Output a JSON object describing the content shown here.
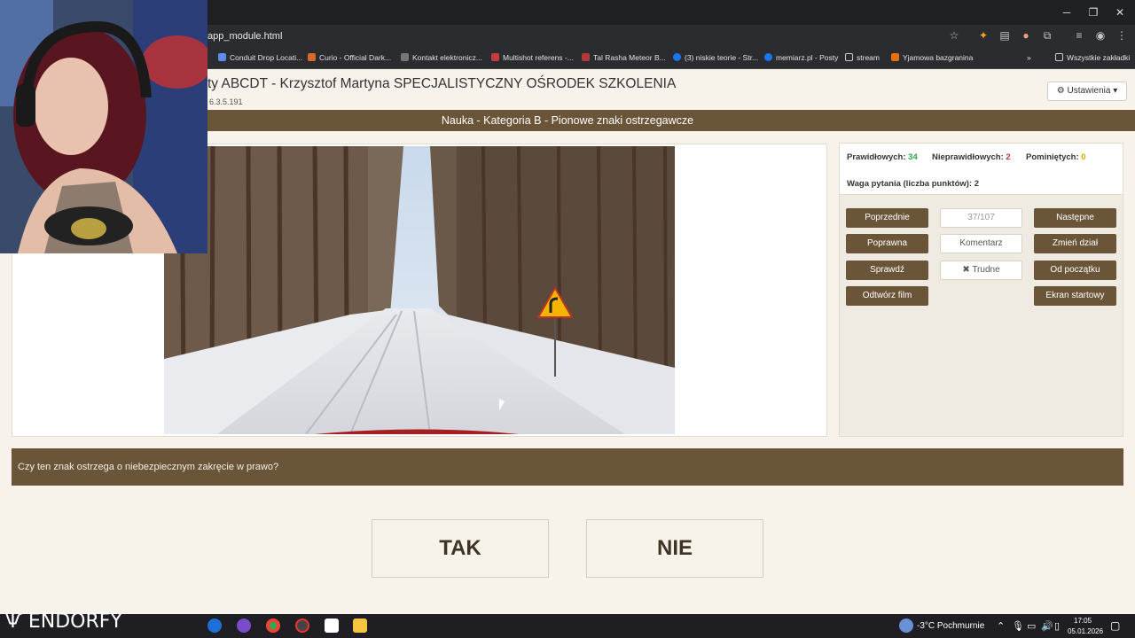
{
  "browser": {
    "url": "app_module.html",
    "bookmarks": [
      {
        "label": "Conduit Drop Locati...",
        "color": "#5a8dee"
      },
      {
        "label": "Curio - Official Dark...",
        "color": "#d86a2a"
      },
      {
        "label": "Kontakt elektronicz...",
        "color": "#777"
      },
      {
        "label": "Multishot referens -...",
        "color": "#c43c3c"
      },
      {
        "label": "Tal Rasha Meteor B...",
        "color": "#b03a3a"
      },
      {
        "label": "(3) niskie teorie - Str...",
        "color": "#1877f2"
      },
      {
        "label": "memiarz.pl - Posty",
        "color": "#1877f2"
      },
      {
        "label": "stream",
        "color": "#888"
      },
      {
        "label": "Yjamowa bazgranina",
        "color": "#e8710a"
      }
    ],
    "all_bookmarks": "Wszystkie zakładki"
  },
  "header": {
    "title": "ty ABCDT - Krzysztof Martyna SPECJALISTYCZNY OŚRODEK SZKOLENIA",
    "version": "6.3.5.191",
    "settings": "Ustawienia"
  },
  "category": "Nauka - Kategoria B - Pionowe znaki ostrzegawcze",
  "stats": {
    "correct_label": "Prawidłowych:",
    "correct_value": "34",
    "correct_color": "#2aa84a",
    "wrong_label": "Nieprawidłowych:",
    "wrong_value": "2",
    "wrong_color": "#c0392b",
    "skipped_label": "Pominiętych:",
    "skipped_value": "0",
    "skipped_color": "#e0a800",
    "weight": "Waga pytania (liczba punktów): 2"
  },
  "controls": {
    "previous": "Poprzednie",
    "counter": "37/107",
    "next": "Następne",
    "correct": "Poprawna",
    "comment": "Komentarz",
    "change_section": "Zmień dział",
    "check": "Sprawdź",
    "difficult": "✖ Trudne",
    "from_start": "Od początku",
    "play_video": "Odtwórz film",
    "start_screen": "Ekran startowy"
  },
  "question": "Czy ten znak ostrzega o niebezpiecznym zakręcie w prawo?",
  "answers": {
    "yes": "TAK",
    "no": "NIE"
  },
  "taskbar": {
    "weather": "-3°C  Pochmurnie",
    "time": "17:05",
    "date": "05.01.2026",
    "watermark": "ENDORFY"
  }
}
